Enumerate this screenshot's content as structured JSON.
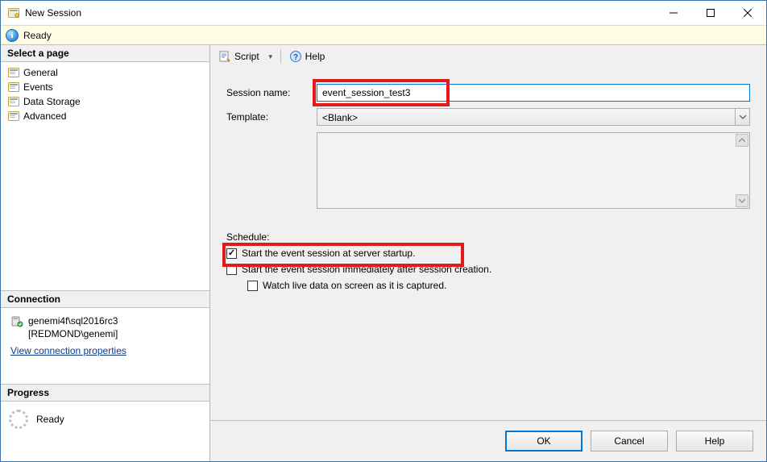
{
  "window": {
    "title": "New Session"
  },
  "status": {
    "text": "Ready"
  },
  "sidebar": {
    "select_page_header": "Select a page",
    "pages": [
      {
        "label": "General",
        "selected": true
      },
      {
        "label": "Events",
        "selected": false
      },
      {
        "label": "Data Storage",
        "selected": false
      },
      {
        "label": "Advanced",
        "selected": false
      }
    ],
    "connection_header": "Connection",
    "connection_line1": "genemi4f\\sql2016rc3",
    "connection_line2": "[REDMOND\\genemi]",
    "view_connection_link": "View connection properties",
    "progress_header": "Progress",
    "progress_text": "Ready"
  },
  "toolbar": {
    "script_label": "Script",
    "help_label": "Help"
  },
  "form": {
    "session_name_label": "Session name:",
    "session_name_value": "event_session_test3",
    "template_label": "Template:",
    "template_value": "<Blank>",
    "description_value": ""
  },
  "schedule": {
    "header": "Schedule:",
    "opt_startup": "Start the event session at server startup.",
    "opt_startup_checked": true,
    "opt_immediate": "Start the event session immediately after session creation.",
    "opt_immediate_checked": false,
    "opt_watch": "Watch live data on screen as it is captured.",
    "opt_watch_checked": false
  },
  "buttons": {
    "ok": "OK",
    "cancel": "Cancel",
    "help": "Help"
  }
}
